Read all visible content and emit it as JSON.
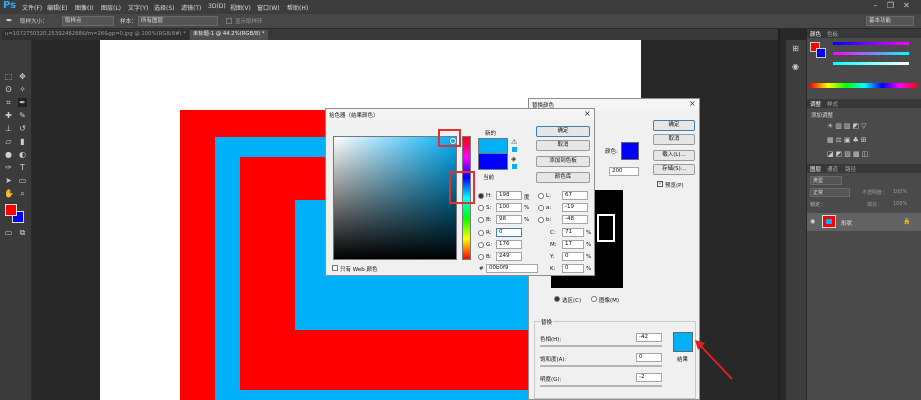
{
  "app": {
    "logo": "Ps"
  },
  "menu": [
    "文件(F)",
    "编辑(E)",
    "图像(I)",
    "图层(L)",
    "文字(Y)",
    "选择(S)",
    "滤镜(T)",
    "3D(D)",
    "视图(V)",
    "窗口(W)",
    "帮助(H)"
  ],
  "options": {
    "size_label": "取样大小：",
    "size_value": "取样点",
    "sample_label": "样本：",
    "sample_value": "所有图层",
    "ring_label": "显示取样环",
    "workspace": "基本功能"
  },
  "tabs": [
    {
      "label": "u=1072750320,2539248288&fm=26&gp=0.jpg @ 100%(RGB/8#) *"
    },
    {
      "label": "未标题-1 @ 44.2%(RGB/8) *"
    }
  ],
  "colors": {
    "red": "#ff0000",
    "blue": "#00b0f9",
    "dark": "#0000ff"
  },
  "right_panels": {
    "color_tabs": [
      "颜色",
      "色板"
    ],
    "adjust_tabs": [
      "调整",
      "样式"
    ],
    "adjust_title": "添加调整",
    "layer_tabs": [
      "图层",
      "通道",
      "路径"
    ],
    "layer_kind": "类型",
    "blend": "正常",
    "opacity_label": "不透明度：",
    "opacity": "100%",
    "lock_label": "锁定：",
    "fill_label": "填充：",
    "fill": "100%",
    "layer_name": "形状"
  },
  "picker": {
    "title": "拾色器（结果颜色）",
    "ok": "确定",
    "cancel": "取消",
    "add_swatch": "添加到色板",
    "libraries": "颜色库",
    "new_label": "新的",
    "current_label": "当前",
    "web_only": "只有 Web 颜色",
    "H": "198",
    "S": "100",
    "Bv": "98",
    "R": "0",
    "G": "176",
    "B": "249",
    "L": "67",
    "a": "-19",
    "b": "-48",
    "C": "71",
    "M": "17",
    "Y": "0",
    "K": "0",
    "hex": "00b0f9",
    "deg": "度",
    "pct": "%",
    "labels": {
      "H": "H:",
      "S": "S:",
      "Bv": "B:",
      "R": "R:",
      "G": "G:",
      "B": "B:",
      "L": "L:",
      "a": "a:",
      "b": "b:",
      "C": "C:",
      "M": "M:",
      "Y": "Y:",
      "K": "K:",
      "hex": "#"
    }
  },
  "replace": {
    "title": "替换颜色",
    "ok": "确定",
    "cancel": "取消",
    "load": "载入(L)...",
    "save": "存储(S)...",
    "color_label": "颜色:",
    "fuzz": "200",
    "preview": "预览(P)",
    "selection": "选区(C)",
    "image": "图像(M)",
    "section": "替换",
    "hue_label": "色相(H):",
    "hue": "-42",
    "sat_label": "饱和度(A):",
    "sat": "0",
    "light_label": "明度(G):",
    "light": "-2",
    "result": "结果"
  }
}
